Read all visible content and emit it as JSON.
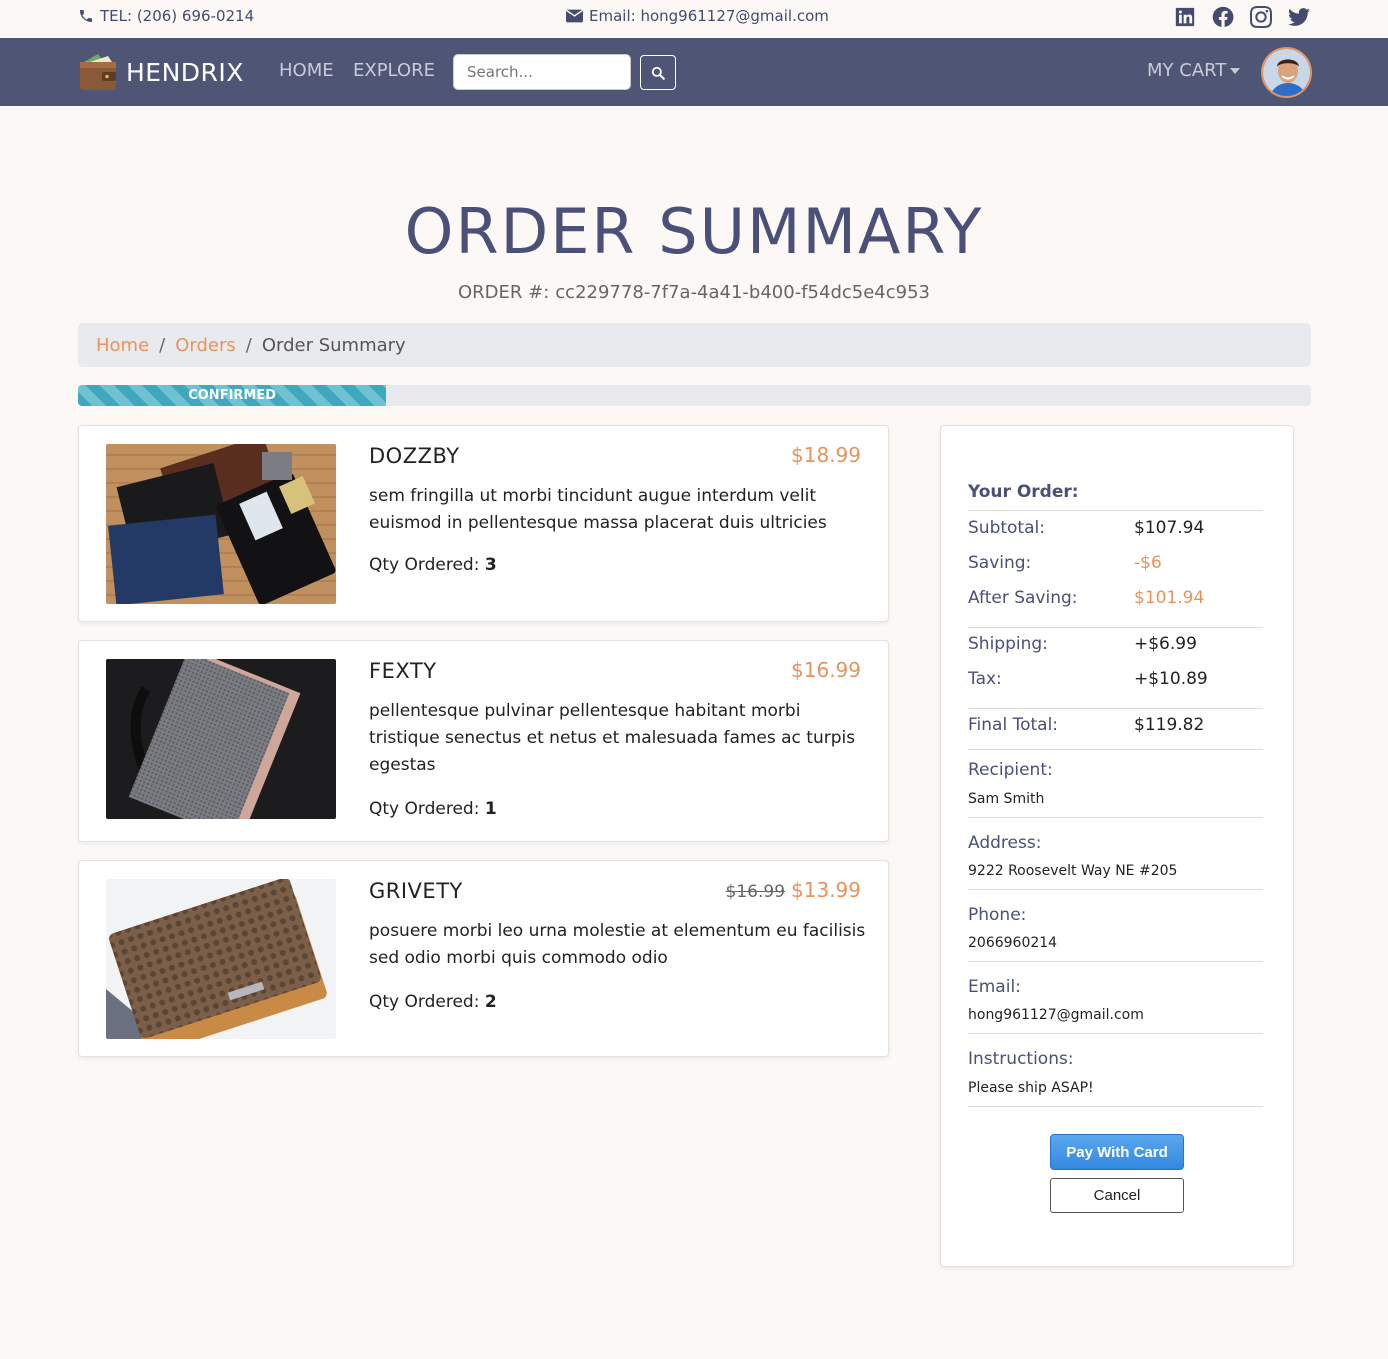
{
  "topbar": {
    "tel": "TEL: (206) 696-0214",
    "email": "Email: hong961127@gmail.com",
    "social_icons": [
      "linkedin-icon",
      "facebook-icon",
      "instagram-icon",
      "twitter-icon"
    ]
  },
  "navbar": {
    "brand": "HENDRIX",
    "links": [
      "HOME",
      "EXPLORE"
    ],
    "search_placeholder": "Search...",
    "cart_label": "MY CART"
  },
  "page": {
    "title": "ORDER SUMMARY",
    "order_label": "ORDER #:",
    "order_id": "cc229778-7f7a-4a41-b400-f54dc5e4c953"
  },
  "breadcrumb": [
    "Home",
    "Orders",
    "Order Summary"
  ],
  "progress": {
    "label": "CONFIRMED",
    "fraction": 0.25
  },
  "items": [
    {
      "name": "DOZZBY",
      "price": "$18.99",
      "old_price": "",
      "description": "sem fringilla ut morbi tincidunt augue interdum velit euismod in pellentesque massa placerat duis ultricies",
      "qty_label": "Qty Ordered:",
      "qty": "3"
    },
    {
      "name": "FEXTY",
      "price": "$16.99",
      "old_price": "",
      "description": "pellentesque pulvinar pellentesque habitant morbi tristique senectus et netus et malesuada fames ac turpis egestas",
      "qty_label": "Qty Ordered:",
      "qty": "1"
    },
    {
      "name": "GRIVETY",
      "price": "$13.99",
      "old_price": "$16.99",
      "description": "posuere morbi leo urna molestie at elementum eu facilisis sed odio morbi quis commodo odio",
      "qty_label": "Qty Ordered:",
      "qty": "2"
    }
  ],
  "summary": {
    "heading": "Your Order:",
    "subtotal_label": "Subtotal:",
    "subtotal": "$107.94",
    "saving_label": "Saving:",
    "saving": "-$6",
    "after_label": "After Saving:",
    "after": "$101.94",
    "shipping_label": "Shipping:",
    "shipping": "+$6.99",
    "tax_label": "Tax:",
    "tax": "+$10.89",
    "final_label": "Final Total:",
    "final": "$119.82",
    "recipient_label": "Recipient:",
    "recipient": "Sam Smith",
    "address_label": "Address:",
    "address": "9222 Roosevelt Way NE #205",
    "phone_label": "Phone:",
    "phone": "2066960214",
    "email_label": "Email:",
    "email": "hong961127@gmail.com",
    "instructions_label": "Instructions:",
    "instructions": "Please ship ASAP!",
    "pay_label": "Pay With Card",
    "cancel_label": "Cancel"
  },
  "colors": {
    "navbar": "#4f5575",
    "accent": "#e8925c",
    "heading": "#4a5077",
    "progress": "#3fa8be"
  }
}
